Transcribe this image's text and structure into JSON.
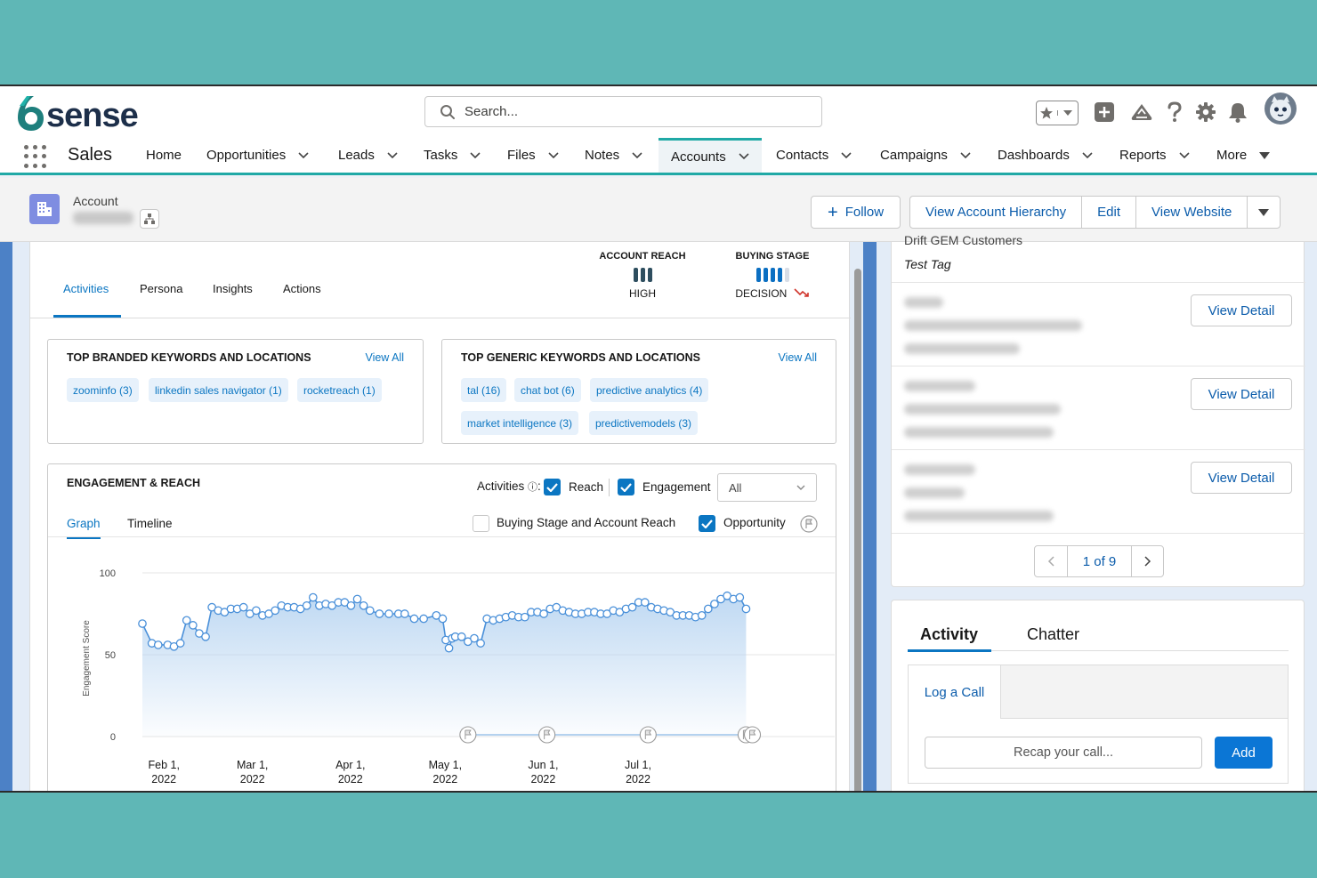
{
  "brand": {
    "logo_text": "6sense",
    "app_name": "Sales",
    "accent": "#20a9a6"
  },
  "search": {
    "placeholder": "Search..."
  },
  "nav": {
    "items": [
      "Home",
      "Opportunities",
      "Leads",
      "Tasks",
      "Files",
      "Notes",
      "Accounts",
      "Contacts",
      "Campaigns",
      "Dashboards",
      "Reports",
      "More"
    ],
    "active": "Accounts"
  },
  "record": {
    "object_label": "Account",
    "buttons": {
      "follow": "Follow",
      "hierarchy": "View Account Hierarchy",
      "edit": "Edit",
      "website": "View Website"
    }
  },
  "sixsense": {
    "tabs": [
      "Activities",
      "Persona",
      "Insights",
      "Actions"
    ],
    "active_tab": "Activities",
    "account_reach": {
      "label": "ACCOUNT REACH",
      "value": "HIGH",
      "level": 3,
      "max": 3,
      "color": "#2e4e5f"
    },
    "buying_stage": {
      "label": "BUYING STAGE",
      "value": "DECISION",
      "level": 4,
      "max": 5,
      "color": "#0b6fc2"
    },
    "branded": {
      "title": "TOP BRANDED KEYWORDS AND LOCATIONS",
      "view_all": "View All",
      "chips": [
        "zoominfo (3)",
        "linkedin sales navigator (1)",
        "rocketreach (1)"
      ]
    },
    "generic": {
      "title": "TOP GENERIC KEYWORDS AND LOCATIONS",
      "view_all": "View All",
      "chips": [
        "tal (16)",
        "chat bot (6)",
        "predictive analytics (4)",
        "market intelligence (3)",
        "predictivemodels (3)"
      ]
    },
    "engagement": {
      "title": "ENGAGEMENT & REACH",
      "activities_label": "Activities",
      "reach_label": "Reach",
      "engagement_label": "Engagement",
      "filter_value": "All",
      "buying_stage_label": "Buying Stage and Account Reach",
      "opportunity_label": "Opportunity",
      "tabs": [
        "Graph",
        "Timeline"
      ],
      "active_tab": "Graph"
    }
  },
  "chart_data": {
    "type": "area",
    "ylabel": "Engagement Score",
    "ylim": [
      0,
      100
    ],
    "yticks": [
      0,
      50,
      100
    ],
    "xlim": [
      "2022-01-28",
      "2022-07-26"
    ],
    "xticks": [
      {
        "date": "2022-02-01",
        "label": [
          "Feb 1,",
          "2022"
        ]
      },
      {
        "date": "2022-03-01",
        "label": [
          "Mar 1,",
          "2022"
        ]
      },
      {
        "date": "2022-04-01",
        "label": [
          "Apr 1,",
          "2022"
        ]
      },
      {
        "date": "2022-05-01",
        "label": [
          "May 1,",
          "2022"
        ]
      },
      {
        "date": "2022-06-01",
        "label": [
          "Jun 1,",
          "2022"
        ]
      },
      {
        "date": "2022-07-01",
        "label": [
          "Jul 1,",
          "2022"
        ]
      }
    ],
    "series": [
      {
        "values": [
          [
            "2022-01-28",
            69
          ],
          [
            "2022-01-31",
            57
          ],
          [
            "2022-02-02",
            56
          ],
          [
            "2022-02-05",
            56
          ],
          [
            "2022-02-07",
            55
          ],
          [
            "2022-02-09",
            57
          ],
          [
            "2022-02-11",
            71
          ],
          [
            "2022-02-13",
            68
          ],
          [
            "2022-02-15",
            63
          ],
          [
            "2022-02-17",
            61
          ],
          [
            "2022-02-19",
            79
          ],
          [
            "2022-02-21",
            77
          ],
          [
            "2022-02-23",
            76
          ],
          [
            "2022-02-25",
            78
          ],
          [
            "2022-02-27",
            78
          ],
          [
            "2022-03-01",
            79
          ],
          [
            "2022-03-03",
            75
          ],
          [
            "2022-03-05",
            77
          ],
          [
            "2022-03-07",
            74
          ],
          [
            "2022-03-09",
            75
          ],
          [
            "2022-03-11",
            77
          ],
          [
            "2022-03-13",
            80
          ],
          [
            "2022-03-15",
            79
          ],
          [
            "2022-03-17",
            79
          ],
          [
            "2022-03-19",
            78
          ],
          [
            "2022-03-21",
            80
          ],
          [
            "2022-03-23",
            85
          ],
          [
            "2022-03-25",
            80
          ],
          [
            "2022-03-27",
            81
          ],
          [
            "2022-03-29",
            80
          ],
          [
            "2022-03-31",
            82
          ],
          [
            "2022-04-02",
            82
          ],
          [
            "2022-04-04",
            80
          ],
          [
            "2022-04-06",
            84
          ],
          [
            "2022-04-08",
            80
          ],
          [
            "2022-04-10",
            77
          ],
          [
            "2022-04-13",
            75
          ],
          [
            "2022-04-16",
            75
          ],
          [
            "2022-04-19",
            75
          ],
          [
            "2022-04-21",
            75
          ],
          [
            "2022-04-24",
            72
          ],
          [
            "2022-04-27",
            72
          ],
          [
            "2022-05-01",
            74
          ],
          [
            "2022-05-03",
            72
          ],
          [
            "2022-05-04",
            59
          ],
          [
            "2022-05-05",
            54
          ],
          [
            "2022-05-06",
            60
          ],
          [
            "2022-05-07",
            61
          ],
          [
            "2022-05-09",
            61
          ],
          [
            "2022-05-11",
            58
          ],
          [
            "2022-05-13",
            60
          ],
          [
            "2022-05-15",
            57
          ],
          [
            "2022-05-17",
            72
          ],
          [
            "2022-05-19",
            71
          ],
          [
            "2022-05-21",
            72
          ],
          [
            "2022-05-23",
            73
          ],
          [
            "2022-05-25",
            74
          ],
          [
            "2022-05-27",
            73
          ],
          [
            "2022-05-29",
            73
          ],
          [
            "2022-05-31",
            76
          ],
          [
            "2022-06-02",
            76
          ],
          [
            "2022-06-04",
            75
          ],
          [
            "2022-06-06",
            78
          ],
          [
            "2022-06-08",
            79
          ],
          [
            "2022-06-10",
            77
          ],
          [
            "2022-06-12",
            76
          ],
          [
            "2022-06-14",
            75
          ],
          [
            "2022-06-16",
            75
          ],
          [
            "2022-06-18",
            76
          ],
          [
            "2022-06-20",
            76
          ],
          [
            "2022-06-22",
            75
          ],
          [
            "2022-06-24",
            75
          ],
          [
            "2022-06-26",
            77
          ],
          [
            "2022-06-28",
            76
          ],
          [
            "2022-06-30",
            78
          ],
          [
            "2022-07-02",
            79
          ],
          [
            "2022-07-04",
            82
          ],
          [
            "2022-07-06",
            82
          ],
          [
            "2022-07-08",
            79
          ],
          [
            "2022-07-10",
            78
          ],
          [
            "2022-07-12",
            77
          ],
          [
            "2022-07-14",
            76
          ],
          [
            "2022-07-16",
            74
          ],
          [
            "2022-07-18",
            74
          ],
          [
            "2022-07-20",
            74
          ],
          [
            "2022-07-22",
            73
          ],
          [
            "2022-07-24",
            74
          ],
          [
            "2022-07-26",
            78
          ],
          [
            "2022-07-28",
            81
          ],
          [
            "2022-07-30",
            84
          ],
          [
            "2022-08-01",
            86
          ],
          [
            "2022-08-03",
            84
          ],
          [
            "2022-08-05",
            85
          ],
          [
            "2022-08-07",
            78
          ]
        ]
      }
    ],
    "opportunity_flags": [
      "2022-05-11",
      "2022-06-05",
      "2022-07-07",
      "2022-08-07",
      "2022-08-09"
    ],
    "colors": {
      "line": "#4a90d9",
      "area": "#bcd7f2",
      "flag_line": "#8ab8e6",
      "grid": "#e5e5e5"
    }
  },
  "right": {
    "truncated_label": "Drift GEM Customers",
    "tag": "Test Tag",
    "view_detail": "View Detail",
    "rows": 3,
    "pager": {
      "text": "1 of 9"
    }
  },
  "activity": {
    "tabs": [
      "Activity",
      "Chatter"
    ],
    "active_tab": "Activity",
    "log_call": "Log a Call",
    "recap_placeholder": "Recap your call...",
    "add": "Add"
  }
}
